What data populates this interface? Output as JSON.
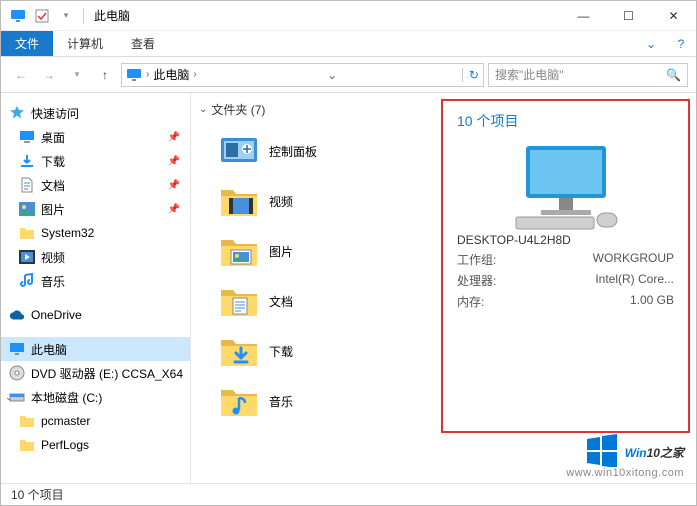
{
  "window": {
    "title": "此电脑",
    "min": "—",
    "max": "☐",
    "close": "✕"
  },
  "ribbon": {
    "file": "文件",
    "computer": "计算机",
    "view": "查看"
  },
  "nav": {
    "location": "此电脑",
    "search_placeholder": "搜索\"此电脑\""
  },
  "sidebar": {
    "quick_access": "快速访问",
    "items_qa": [
      {
        "label": "桌面",
        "pin": true
      },
      {
        "label": "下载",
        "pin": true
      },
      {
        "label": "文档",
        "pin": true
      },
      {
        "label": "图片",
        "pin": true
      },
      {
        "label": "System32",
        "pin": false
      },
      {
        "label": "视频",
        "pin": false
      },
      {
        "label": "音乐",
        "pin": false
      }
    ],
    "onedrive": "OneDrive",
    "this_pc": "此电脑",
    "dvd": "DVD 驱动器 (E:) CCSA_X64",
    "local_disk": "本地磁盘 (C:)",
    "disk_children": [
      {
        "label": "pcmaster"
      },
      {
        "label": "PerfLogs"
      }
    ]
  },
  "content": {
    "folders_header": "文件夹 (7)",
    "folders": [
      {
        "label": "控制面板"
      },
      {
        "label": "视频"
      },
      {
        "label": "图片"
      },
      {
        "label": "文档"
      },
      {
        "label": "下载"
      },
      {
        "label": "音乐"
      }
    ]
  },
  "details": {
    "title": "10 个项目",
    "computer_name": "DESKTOP-U4L2H8D",
    "rows": [
      {
        "k": "工作组:",
        "v": "WORKGROUP"
      },
      {
        "k": "处理器:",
        "v": "Intel(R) Core..."
      },
      {
        "k": "内存:",
        "v": "1.00 GB"
      }
    ]
  },
  "status": {
    "text": "10 个项目"
  },
  "watermark": {
    "brand_a": "Win",
    "brand_b": "10",
    "brand_c": "之家",
    "url": "www.win10xitong.com"
  }
}
